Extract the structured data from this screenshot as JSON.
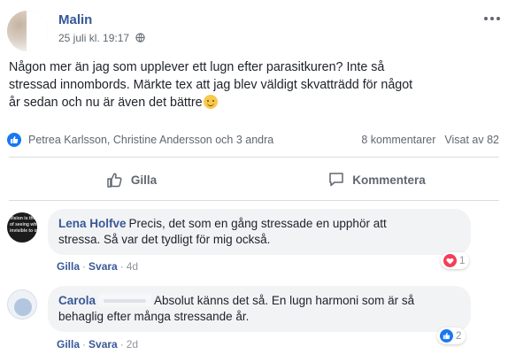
{
  "post": {
    "author": "Malin",
    "timestamp": "25 juli kl. 19:17",
    "text_lines": [
      "Någon mer än jag som upplever ett lugn efter parasitkuren? Inte så",
      "stressad innombords. Märkte tex att jag blev väldigt skvatträdd för något",
      "år sedan och nu är även det bättre"
    ],
    "reactors": "Petrea Karlsson, Christine Andersson och 3 andra",
    "comments_count": "8 kommentarer",
    "views": "Visat av 82"
  },
  "actions": {
    "like_label": "Gilla",
    "comment_label": "Kommentera"
  },
  "comments": [
    {
      "author": "Lena Holfve",
      "text": "Precis, det som en gång stressade en upphör att",
      "text2": "stressa. Så var det tydligt för mig också.",
      "like_label": "Gilla",
      "reply_label": "Svara",
      "time": "4d",
      "reaction_count": "1",
      "reaction_type": "heart-icon"
    },
    {
      "author": "Carola",
      "text": "Absolut känns det så. En lugn harmoni som är så",
      "text2": "behaglig efter många stressande år.",
      "like_label": "Gilla",
      "reply_label": "Svara",
      "time": "2d",
      "reaction_count": "2",
      "reaction_type": "like-icon"
    }
  ],
  "colors": {
    "link": "#385898",
    "accent": "#1877f2",
    "muted": "#606770",
    "heart": "#f33e58"
  }
}
